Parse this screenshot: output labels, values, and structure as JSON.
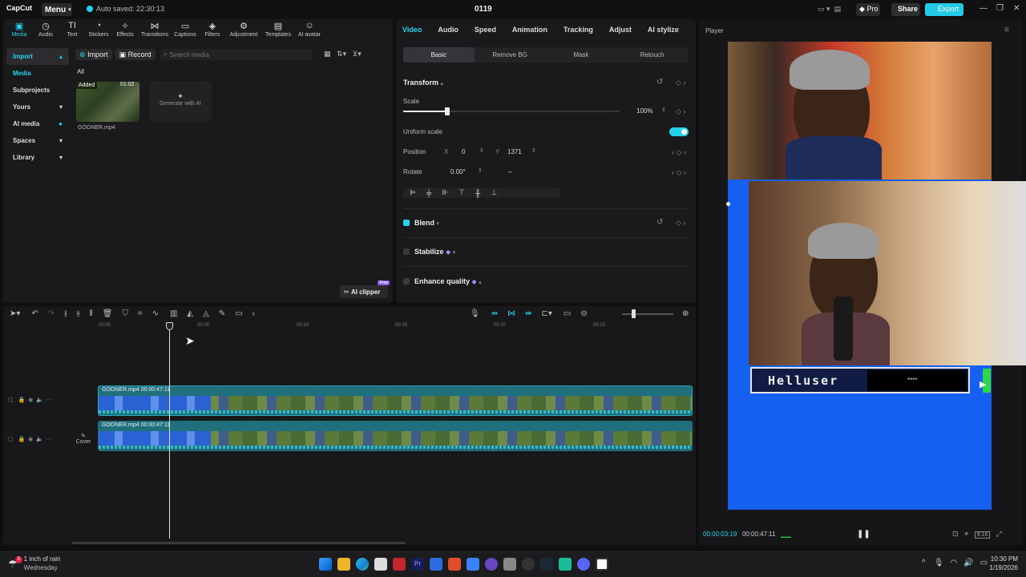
{
  "titlebar": {
    "logo": "CapCut",
    "menu_label": "Menu",
    "autosave": "Auto saved: 22:30:13",
    "project_title": "0119",
    "pro_label": "Pro",
    "share_label": "Share",
    "export_label": "Export"
  },
  "toolbar": {
    "tabs": [
      {
        "label": "Media",
        "icon": "▣"
      },
      {
        "label": "Audio",
        "icon": "◷"
      },
      {
        "label": "Text",
        "icon": "TI"
      },
      {
        "label": "Stickers",
        "icon": "◔"
      },
      {
        "label": "Effects",
        "icon": "✧"
      },
      {
        "label": "Transitions",
        "icon": "⋈"
      },
      {
        "label": "Captions",
        "icon": "▭"
      },
      {
        "label": "Filters",
        "icon": "◈"
      },
      {
        "label": "Adjustment",
        "icon": "⚙"
      },
      {
        "label": "Templates",
        "icon": "▤"
      },
      {
        "label": "AI avatar",
        "icon": "☺"
      }
    ]
  },
  "left_nav": {
    "items": [
      {
        "label": "Import",
        "arrow": "▴"
      },
      {
        "label": "Media",
        "arrow": ""
      },
      {
        "label": "Subprojects",
        "arrow": ""
      },
      {
        "label": "Yours",
        "arrow": "▾"
      },
      {
        "label": "AI media",
        "arrow": "●"
      },
      {
        "label": "Spaces",
        "arrow": "▾"
      },
      {
        "label": "Library",
        "arrow": "▾"
      }
    ]
  },
  "media": {
    "import_label": "Import",
    "record_label": "Record",
    "search_placeholder": "Search media",
    "filter_label": "All",
    "clip": {
      "added": "Added",
      "duration": "01:02",
      "name": "GOONER.mp4"
    },
    "generate_label": "Generate with AI",
    "ai_clipper_label": "AI clipper",
    "ai_clipper_badge": "Free"
  },
  "properties": {
    "tabs": [
      "Video",
      "Audio",
      "Speed",
      "Animation",
      "Tracking",
      "Adjust",
      "AI stylize"
    ],
    "subtabs": [
      "Basic",
      "Remove BG",
      "Mask",
      "Retouch"
    ],
    "transform_title": "Transform",
    "scale_label": "Scale",
    "scale_value": "100%",
    "scale_fraction": 0.2,
    "uniform_label": "Uniform scale",
    "position_label": "Position",
    "x_label": "X",
    "x_value": "0",
    "y_label": "Y",
    "y_value": "1371",
    "rotate_label": "Rotate",
    "rotate_value": "0.00°",
    "blend_label": "Blend",
    "stabilize_label": "Stabilize",
    "enhance_label": "Enhance quality"
  },
  "player": {
    "label": "Player",
    "overlay_name": "Helluser",
    "overlay_stars": "****",
    "current_time": "00:00:03:19",
    "total_time": "00:00:47:11",
    "ratio": "9:16"
  },
  "timeline": {
    "ruler": [
      "00:00",
      "00:05",
      "00:10",
      "00:15",
      "00:20",
      "00:25"
    ],
    "tracks": [
      {
        "label": "GOONER.mp4   00:00:47:11"
      },
      {
        "label": "GOONER.mp4   00:00:47:11"
      }
    ],
    "cover_label": "Cover"
  },
  "taskbar": {
    "weather_title": "1 inch of rain",
    "weather_sub": "Wednesday",
    "weather_badge": "3",
    "time": "10:30 PM",
    "date": "1/19/2026"
  },
  "colors": {
    "accent": "#22d3ee",
    "canvas_bg": "#1560f0"
  }
}
